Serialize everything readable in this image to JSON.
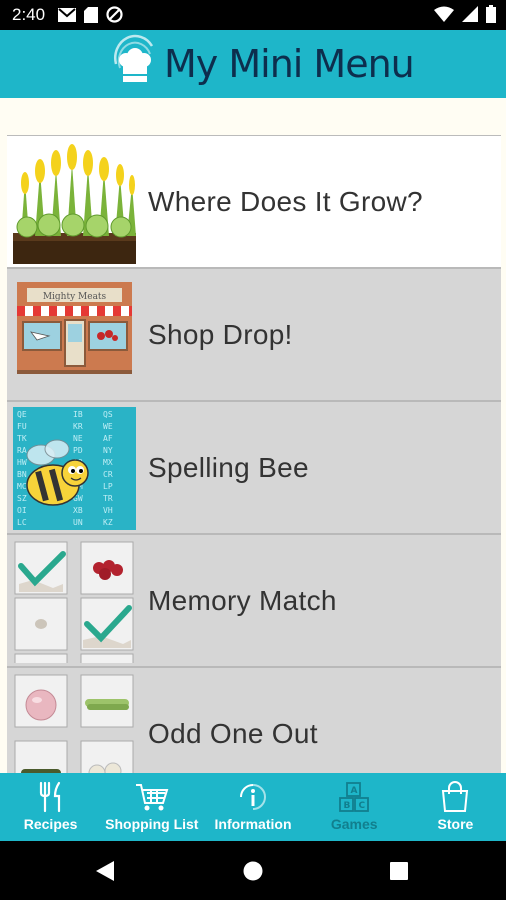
{
  "status_bar": {
    "time": "2:40"
  },
  "header": {
    "title": "My Mini Menu"
  },
  "games": [
    {
      "label": "Where Does It Grow?",
      "selected": true
    },
    {
      "label": "Shop Drop!",
      "selected": false,
      "sign": "Mighty Meats"
    },
    {
      "label": "Spelling Bee",
      "selected": false
    },
    {
      "label": "Memory Match",
      "selected": false
    },
    {
      "label": "Odd One Out",
      "selected": false
    }
  ],
  "bottom_nav": [
    {
      "label": "Recipes",
      "icon": "fork-knife-icon"
    },
    {
      "label": "Shopping List",
      "icon": "cart-icon"
    },
    {
      "label": "Information",
      "icon": "info-icon"
    },
    {
      "label": "Games",
      "icon": "blocks-icon",
      "active": true
    },
    {
      "label": "Store",
      "icon": "bag-icon"
    }
  ],
  "colors": {
    "accent": "#1eb6c9",
    "title": "#0d2e4d",
    "row_bg": "#d6d6d6",
    "selected_row_bg": "#ffffff"
  }
}
